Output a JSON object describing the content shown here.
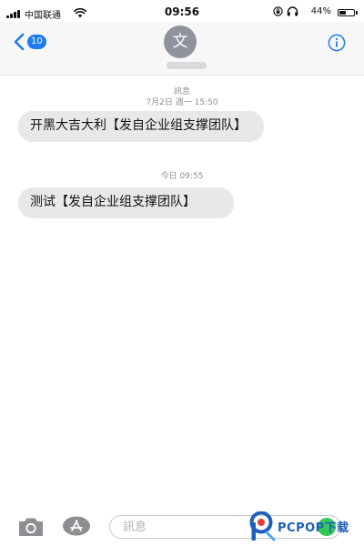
{
  "status_bar": {
    "carrier": "中国联通",
    "time": "09:56",
    "battery_percent": "44%",
    "battery_level": 0.44,
    "icons": [
      "signal-icon",
      "wifi-icon",
      "rotation-lock-icon",
      "headphones-icon",
      "battery-icon"
    ]
  },
  "header": {
    "back_badge": "10",
    "avatar_initial": "文",
    "icons": [
      "chevron-left-icon",
      "info-icon"
    ]
  },
  "conversation": {
    "service": "訊息",
    "messages": [
      {
        "timestamp": "7月2日 週一 15:50",
        "text": "开黑大吉大利【发自企业组支撑团队】"
      },
      {
        "timestamp": "今日 09:55",
        "text": "测试【发自企业组支撑团队】"
      }
    ]
  },
  "input_bar": {
    "placeholder": "訊息",
    "icons": [
      "camera-icon",
      "app-store-icon",
      "microphone-icon"
    ]
  },
  "colors": {
    "accent": "#1f7bf2",
    "bubble": "#e8e8ea",
    "mic_green": "#34c759",
    "avatar": "#8f939b"
  },
  "watermark": {
    "brand": "PCPOP下载"
  }
}
